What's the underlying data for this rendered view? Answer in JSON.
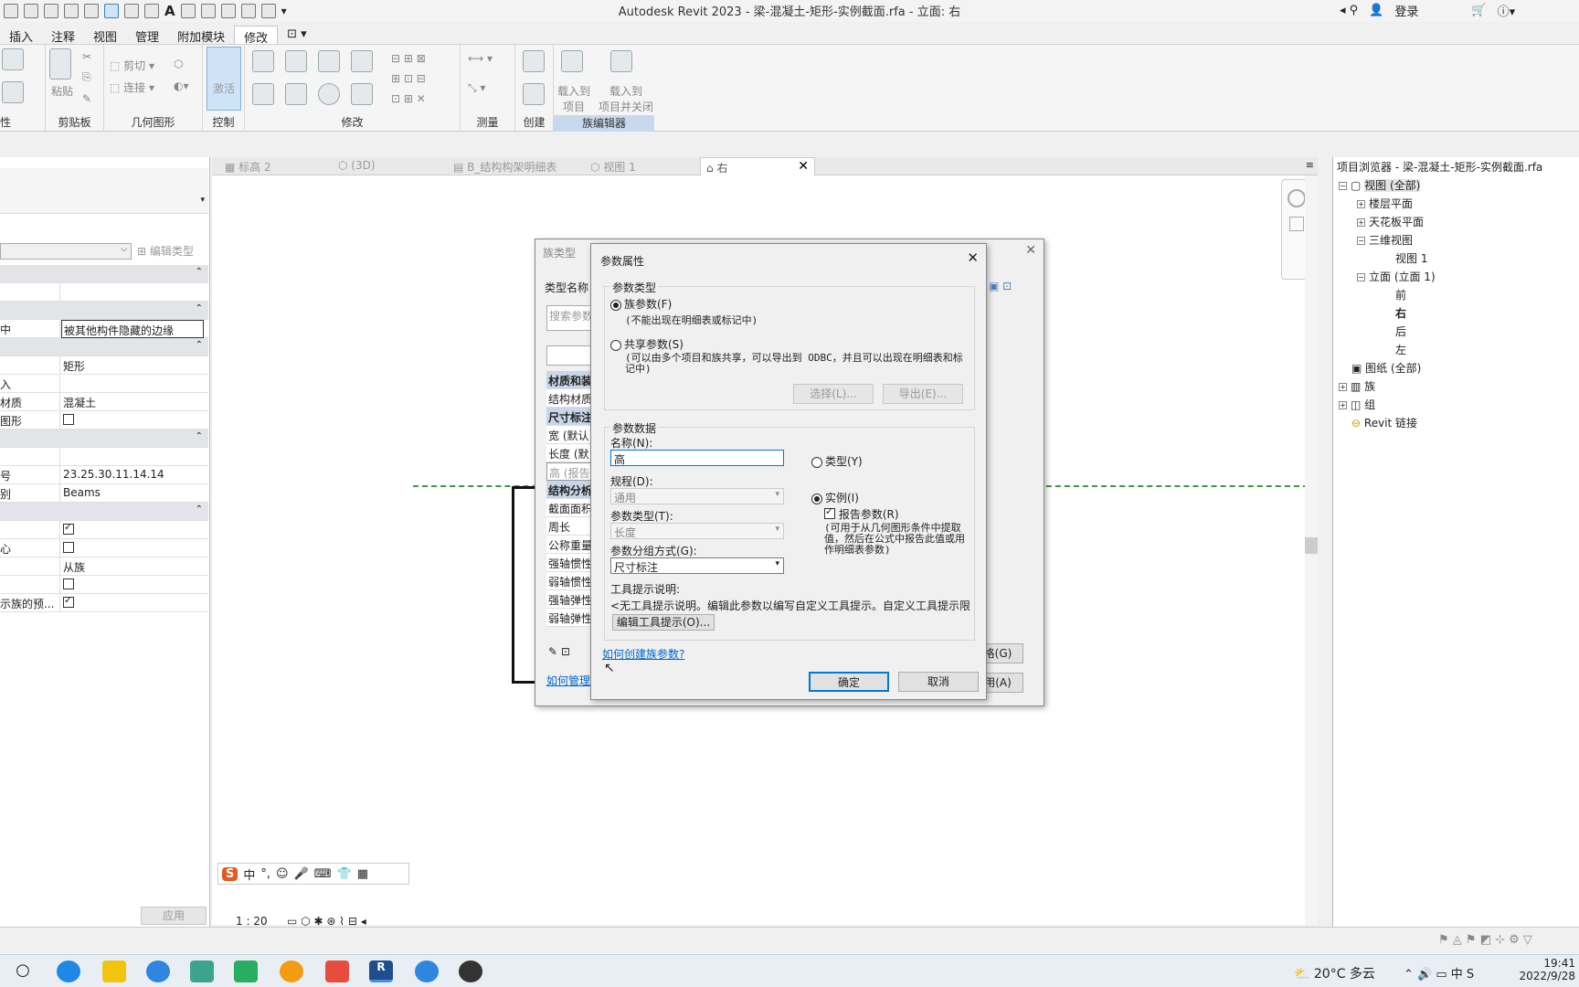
{
  "window": {
    "title": "Autodesk Revit 2023 - 梁-混凝土-矩形-实例截面.rfa - 立面: 右",
    "login": "登录"
  },
  "ribbon_tabs": [
    "插入",
    "注释",
    "视图",
    "管理",
    "附加模块",
    "修改"
  ],
  "ribbon_panels": {
    "clipboard": "剪贴板",
    "geometry": "几何图形",
    "control": "控制",
    "modify": "修改",
    "measure": "测量",
    "create": "创建",
    "family_editor": "族编辑器",
    "paste": "粘贴",
    "cut": "剪切",
    "join": "连接",
    "activate": "激活",
    "load_into_project": "载入到\n项目",
    "load_close": "载入到\n项目并关闭",
    "left_cut": "性"
  },
  "properties": {
    "edit_type": "编辑类型",
    "rows": [
      {
        "k": "",
        "v": "",
        "sec": true
      },
      {
        "k": "",
        "v": ""
      },
      {
        "k": "",
        "v": "",
        "sec": true
      },
      {
        "k": "中",
        "v": "被其他构件隐藏的边缘"
      },
      {
        "k": "",
        "v": "",
        "sec": true
      },
      {
        "k": "",
        "v": "矩形"
      },
      {
        "k": "入",
        "v": ""
      },
      {
        "k": "材质",
        "v": "混凝土"
      },
      {
        "k": "图形",
        "v": "",
        "chk": false
      },
      {
        "k": "",
        "v": "",
        "sec": true
      },
      {
        "k": "",
        "v": ""
      },
      {
        "k": "号",
        "v": "23.25.30.11.14.14"
      },
      {
        "k": "别",
        "v": "Beams"
      },
      {
        "k": "",
        "v": "",
        "sec": true
      },
      {
        "k": "",
        "v": "",
        "chk": true
      },
      {
        "k": "心",
        "v": "",
        "chk": false
      },
      {
        "k": "",
        "v": "从族"
      },
      {
        "k": "",
        "v": "",
        "chk": false
      },
      {
        "k": "示族的预...",
        "v": "",
        "chk": true
      }
    ],
    "apply": "应用"
  },
  "view_tabs": [
    "标高 2",
    "(3D)",
    "B_结构构架明细表",
    "视图 1",
    "右"
  ],
  "project_browser": {
    "title": "项目浏览器 - 梁-混凝土-矩形-实例截面.rfa",
    "nodes": [
      "视图 (全部)",
      "楼层平面",
      "天花板平面",
      "三维视图",
      "视图 1",
      "立面 (立面 1)",
      "前",
      "右",
      "后",
      "左",
      "图纸 (全部)",
      "族",
      "组",
      "Revit 链接"
    ]
  },
  "family_types_dialog": {
    "title": "族类型",
    "type_name": "类型名称",
    "search": "搜索参数",
    "rows": [
      "材质和装",
      "结构材质",
      "尺寸标注",
      "宽 (默认",
      "长度 (默",
      "高 (报告",
      "结构分析",
      "截面面积",
      "周长",
      "公称重量",
      "强轴惯性",
      "弱轴惯性",
      "强轴弹性",
      "弱轴弹性"
    ],
    "manage_link": "如何管理",
    "table_btn": "格(G)",
    "apply_btn": "用(A)"
  },
  "param_dialog": {
    "title": "参数属性",
    "param_type_group": "参数类型",
    "family_param": "族参数(F)",
    "family_param_note": "(不能出现在明细表或标记中)",
    "shared_param": "共享参数(S)",
    "shared_param_note": "(可以由多个项目和族共享，可以导出到 ODBC，并且可以出现在明细表和标记中)",
    "select_btn": "选择(L)...",
    "export_btn": "导出(E)...",
    "param_data_group": "参数数据",
    "name_label": "名称(N):",
    "name_value": "高",
    "discipline_label": "规程(D):",
    "discipline_value": "通用",
    "ptype_label": "参数类型(T):",
    "ptype_value": "长度",
    "group_label": "参数分组方式(G):",
    "group_value": "尺寸标注",
    "type_radio": "类型(Y)",
    "instance_radio": "实例(I)",
    "report_param": "报告参数(R)",
    "report_note": "(可用于从几何图形条件中提取值，然后在公式中报告此值或用作明细表参数)",
    "tooltip_label": "工具提示说明:",
    "tooltip_text": "<无工具提示说明。编辑此参数以编写自定义工具提示。自定义工具提示限",
    "edit_tooltip_btn": "编辑工具提示(O)...",
    "how_link": "如何创建族参数?",
    "ok": "确定",
    "cancel": "取消"
  },
  "status": {
    "scale": "1 : 20"
  },
  "ime": {
    "mode": "中"
  },
  "taskbar": {
    "weather": "20°C 多云",
    "ime": "中",
    "time": "19:41",
    "date": "2022/9/28"
  }
}
